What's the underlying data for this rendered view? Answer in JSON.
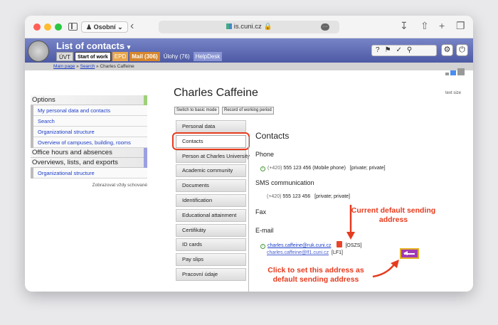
{
  "browser": {
    "profile": "Osobní",
    "url": "is.cuni.cz",
    "colors": {
      "close": "#ff5f57",
      "minimize": "#febc2e",
      "zoom": "#28c840"
    }
  },
  "app": {
    "title": "List of contacts",
    "tabs": [
      "ÚVT",
      "Start of work",
      "EPD",
      "Mail (306)",
      "Úlohy (76)",
      "HelpDesk"
    ],
    "tab_colors": {
      "epd": "#e9a64a",
      "mail": "#d7862c",
      "header": "#5b68b4"
    }
  },
  "breadcrumb": {
    "main": "Main page",
    "sep": "»",
    "search": "Search",
    "current": "Charles Caffeine"
  },
  "sidebar": {
    "sections": [
      {
        "label": "Options",
        "items": [
          "My personal data and contacts",
          "Search",
          "Organizational structure",
          "Overview of campuses, building, rooms"
        ]
      },
      {
        "label": "Office hours and absences",
        "items": []
      },
      {
        "label": "Overviews, lists, and exports",
        "items": [
          "Organizational structure"
        ]
      }
    ],
    "note": "Zobrazovat vždy schované"
  },
  "page": {
    "title": "Charles Caffeine",
    "text_size": "text size",
    "mode_buttons": [
      "Switch to basic mode",
      "Record of working period"
    ]
  },
  "tabs": [
    "Personal data",
    "Contacts",
    "Person at Charles University",
    "Academic community",
    "Documents",
    "Identification",
    "Educational attainment",
    "Certifikáty",
    "ID cards",
    "Pay slips",
    "Pracovní údaje"
  ],
  "active_tab": "Contacts",
  "contacts": {
    "title": "Contacts",
    "phone_label": "Phone",
    "phone": {
      "prefix": "(+420)",
      "number": "555 123 456 (Mobile phone)",
      "tag": "[private; private]"
    },
    "sms_label": "SMS communication",
    "sms": {
      "prefix": "(+420)",
      "number": "555 123 456",
      "tag": "[private; private]"
    },
    "fax_label": "Fax",
    "email_label": "E-mail",
    "emails": [
      {
        "address": "charles.caffeine@ruk.cuni.cz",
        "tag": "[OSZS]"
      },
      {
        "address": "charles.caffeine@lf1.cuni.cz",
        "tag": "[LF1]"
      }
    ]
  },
  "annotations": {
    "current_default": "Current default sending address",
    "click_to_set": "Click to set this address as default sending address",
    "color": "#e63b1e"
  }
}
